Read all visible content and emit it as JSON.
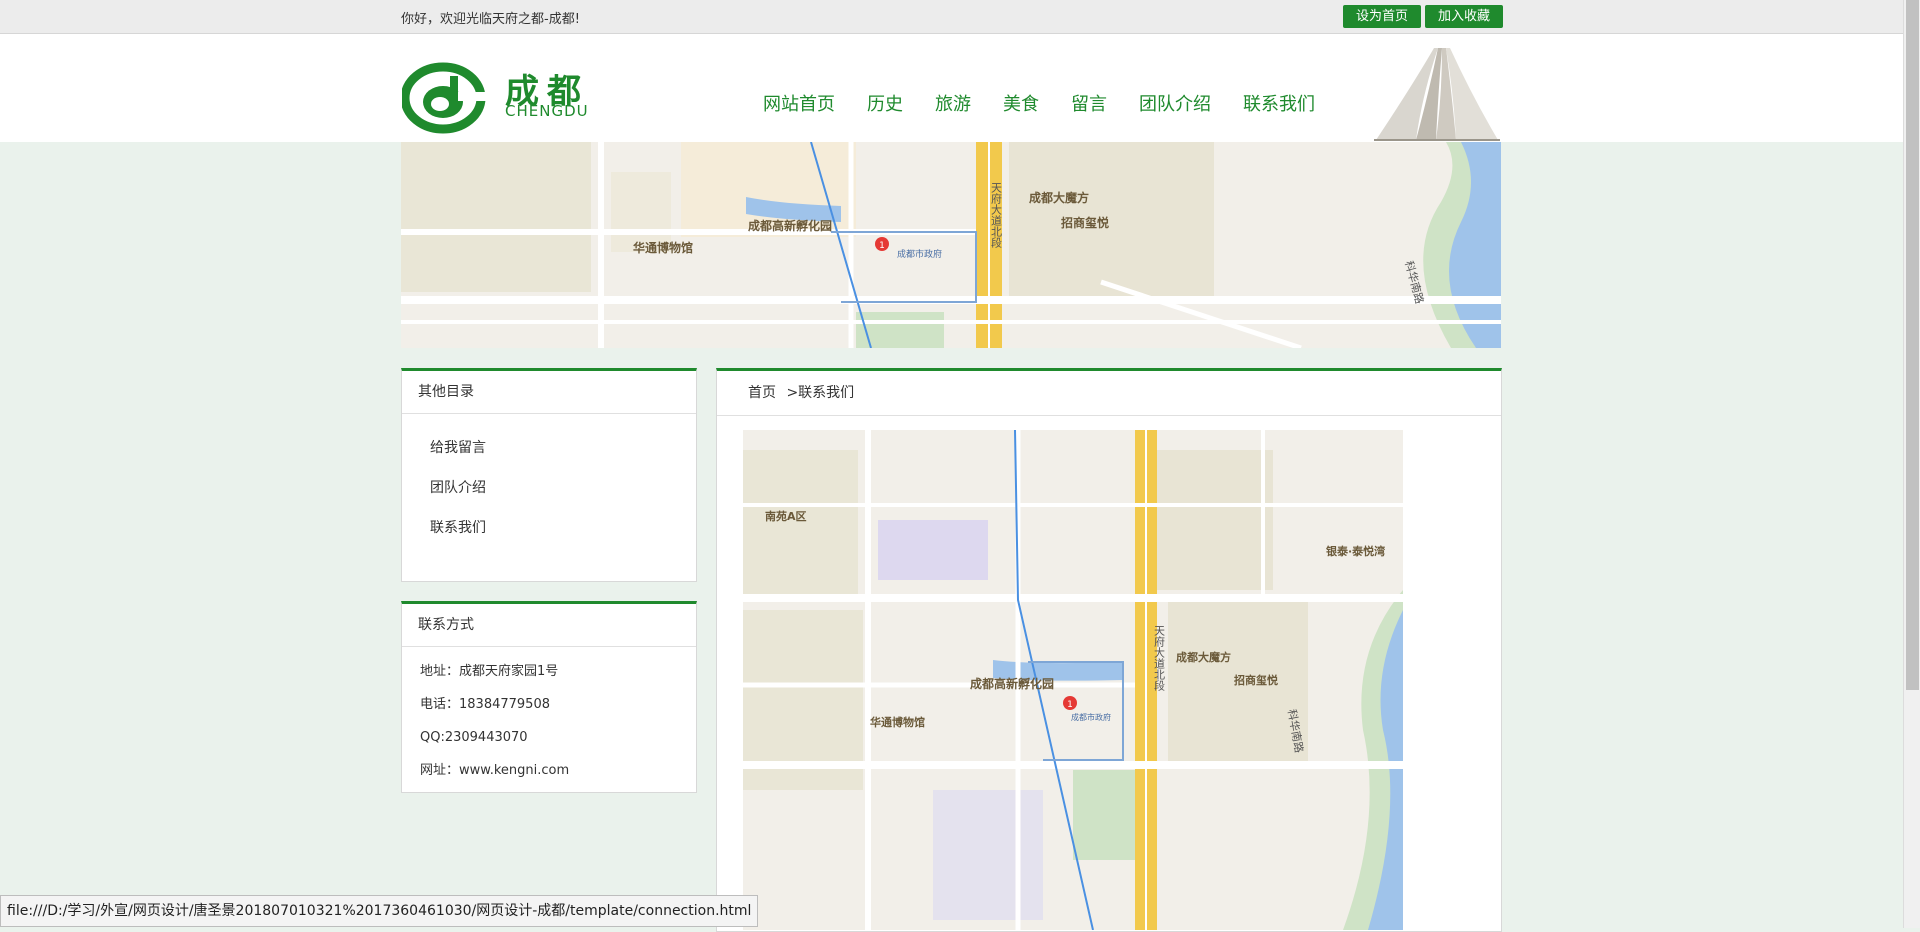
{
  "topbar": {
    "welcome": "你好，欢迎光临天府之都-成都!",
    "set_home": "设为首页",
    "add_favorite": "加入收藏"
  },
  "logo": {
    "chinese": "成都",
    "english": "CHENGDU"
  },
  "nav": [
    {
      "label": "网站首页"
    },
    {
      "label": "历史"
    },
    {
      "label": "旅游"
    },
    {
      "label": "美食"
    },
    {
      "label": "留言"
    },
    {
      "label": "团队介绍"
    },
    {
      "label": "联系我们"
    }
  ],
  "sidebar": {
    "title": "其他目录",
    "items": [
      {
        "label": "给我留言"
      },
      {
        "label": "团队介绍"
      },
      {
        "label": "联系我们"
      }
    ]
  },
  "contact": {
    "title": "联系方式",
    "address": "地址：成都天府家园1号",
    "phone": "电话：18384779508",
    "qq": "QQ:2309443070",
    "website": "网址：www.kengni.com"
  },
  "breadcrumb": {
    "home": "首页",
    "current": ">联系我们"
  },
  "map_labels": {
    "incubator": "成都高新孵化园",
    "museum": "华通博物馆",
    "mall": "成都大魔方",
    "zhaoshang": "招商玺悦",
    "road": "天府大道北段",
    "gov": "成都市政府",
    "nanyuan": "南苑A区",
    "yintai": "银泰·泰悦湾",
    "kehua": "科华南路",
    "marker": "1"
  },
  "colors": {
    "brand": "#1f8a2d",
    "road": "#f2c94c",
    "river": "#9fc3ea",
    "park": "#cfe3c6"
  },
  "status_url": "file:///D:/学习/外宣/网页设计/唐圣景201807010321%2017360461030/网页设计-成都/template/connection.html"
}
